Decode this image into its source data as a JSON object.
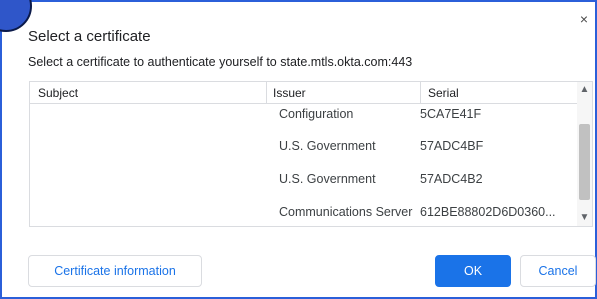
{
  "dialog": {
    "title": "Select a certificate",
    "subtitle": "Select a certificate to authenticate yourself to state.mtls.okta.com:443",
    "close_glyph": "×"
  },
  "table": {
    "columns": [
      "Subject",
      "Issuer",
      "Serial"
    ],
    "rows": [
      {
        "subject": "",
        "issuer": "Configuration",
        "serial": "5CA7E41F"
      },
      {
        "subject": "",
        "issuer": "U.S. Government",
        "serial": "57ADC4BF"
      },
      {
        "subject": "",
        "issuer": "U.S. Government",
        "serial": "57ADC4B2"
      },
      {
        "subject": "",
        "issuer": "Communications Server",
        "serial": "612BE88802D6D0360..."
      }
    ]
  },
  "buttons": {
    "info_label": "Certificate information",
    "ok_label": "OK",
    "cancel_label": "Cancel"
  },
  "colors": {
    "accent": "#1a73e8",
    "border": "#2b5fd9",
    "badge": "#2f56c9"
  }
}
